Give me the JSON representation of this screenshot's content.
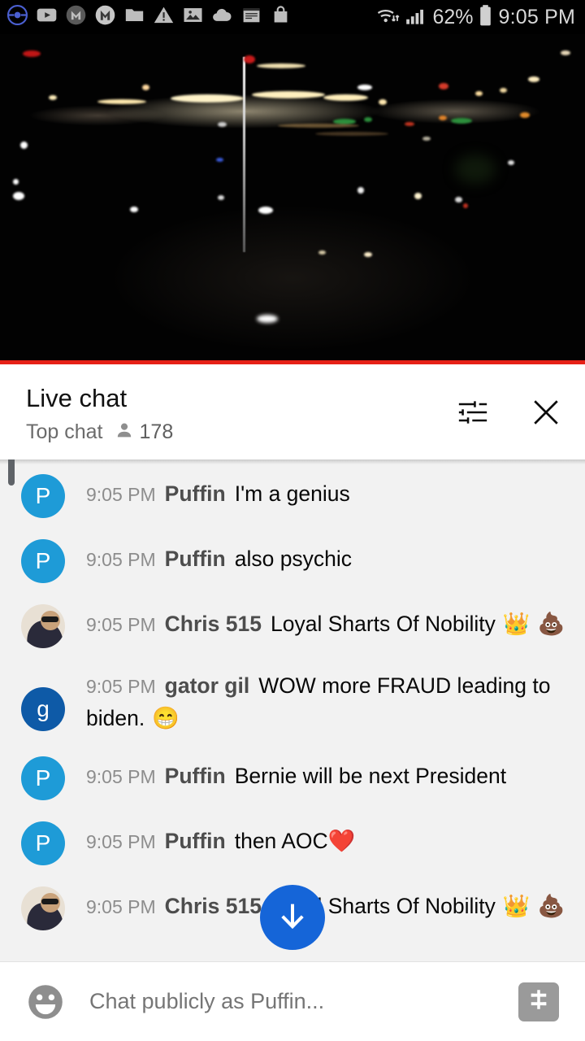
{
  "status_bar": {
    "icons": [
      "pokeball-icon",
      "youtube-icon",
      "m-filled-icon",
      "m-outline-icon",
      "folder-icon",
      "warning-icon",
      "photo-icon",
      "cloud-icon",
      "notepad-icon",
      "shopping-bag-icon"
    ],
    "wifi": "wifi-icon",
    "signal": "cellular-signal-icon",
    "battery_percent": "62%",
    "battery": "battery-icon",
    "clock": "9:05 PM"
  },
  "video": {
    "description": "night-cityscape-livestream",
    "progress_percent": 100,
    "progress_color": "#e62117"
  },
  "chat_header": {
    "title": "Live chat",
    "subtitle": "Top chat",
    "viewer_count": "178",
    "viewer_icon": "person-icon",
    "settings_icon": "tune-sliders-icon",
    "close_icon": "close-x-icon"
  },
  "messages": [
    {
      "avatar_type": "photo",
      "avatar_letter": "",
      "timestamp": "",
      "author": "",
      "text": "",
      "emojis": [],
      "partial_top": true
    },
    {
      "avatar_type": "initial",
      "avatar_color": "#1e9bd7",
      "avatar_letter": "P",
      "timestamp": "9:05 PM",
      "author": "Puffin",
      "text": "I'm a genius",
      "emojis": []
    },
    {
      "avatar_type": "initial",
      "avatar_color": "#1e9bd7",
      "avatar_letter": "P",
      "timestamp": "9:05 PM",
      "author": "Puffin",
      "text": "also psychic",
      "emojis": []
    },
    {
      "avatar_type": "photo",
      "avatar_letter": "",
      "timestamp": "9:05 PM",
      "author": "Chris 515",
      "text": "Loyal Sharts Of Nobility",
      "emojis": [
        "👑",
        "💩"
      ]
    },
    {
      "avatar_type": "initial",
      "avatar_color": "#0e5aa7",
      "avatar_letter": "g",
      "timestamp": "9:05 PM",
      "author": "gator gil",
      "text": "WOW more FRAUD leading to biden.",
      "emojis": [
        "😁"
      ]
    },
    {
      "avatar_type": "initial",
      "avatar_color": "#1e9bd7",
      "avatar_letter": "P",
      "timestamp": "9:05 PM",
      "author": "Puffin",
      "text": "Bernie will be next President",
      "emojis": []
    },
    {
      "avatar_type": "initial",
      "avatar_color": "#1e9bd7",
      "avatar_letter": "P",
      "timestamp": "9:05 PM",
      "author": "Puffin",
      "text": "then AOC",
      "emojis": [
        "❤️"
      ]
    },
    {
      "avatar_type": "photo",
      "avatar_letter": "",
      "timestamp": "9:05 PM",
      "author": "Chris 515",
      "text": "Loyal Sharts Of Nobility",
      "emojis": [
        "👑",
        "💩"
      ],
      "obscured_by_fab": true
    }
  ],
  "scroll_fab": {
    "icon": "arrow-down-icon",
    "color": "#1565d8"
  },
  "input_bar": {
    "emoji_icon": "emoji-smiley-icon",
    "placeholder": "Chat publicly as Puffin...",
    "value": "",
    "super_chat_icon": "dollar-money-icon"
  }
}
